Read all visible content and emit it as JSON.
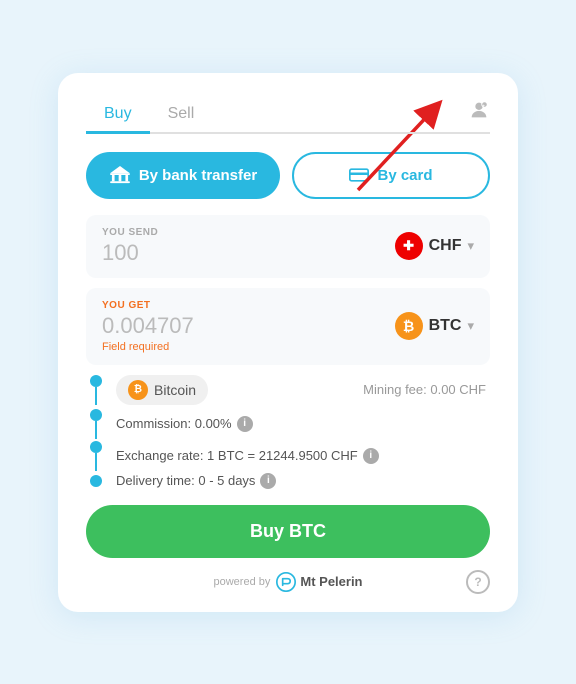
{
  "tabs": {
    "buy": "Buy",
    "sell": "Sell"
  },
  "payment": {
    "bank_label": "By bank transfer",
    "card_label": "By card"
  },
  "send": {
    "label": "YOU SEND",
    "value": "100",
    "currency": "CHF",
    "chevron": "▾"
  },
  "get": {
    "label": "YOU GET",
    "value": "0.004707",
    "currency": "BTC",
    "field_required": "Field required",
    "chevron": "▾"
  },
  "coin": {
    "name": "Bitcoin",
    "mining_fee_label": "Mining fee: 0.00 CHF"
  },
  "commission": {
    "label": "Commission: 0.00%",
    "info": "i"
  },
  "exchange_rate": {
    "label": "Exchange rate: 1 BTC = 21244.9500 CHF",
    "info": "i"
  },
  "delivery": {
    "label": "Delivery time: 0 - 5 days",
    "info": "i"
  },
  "buy_button": "Buy BTC",
  "footer": {
    "powered_by": "powered by",
    "brand": "Mt\nPelerin",
    "help": "?"
  }
}
